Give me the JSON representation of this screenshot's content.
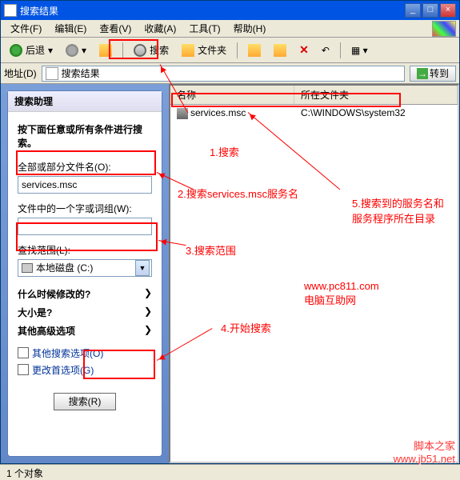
{
  "title": "搜索结果",
  "menu": {
    "file": "文件(F)",
    "edit": "编辑(E)",
    "view": "查看(V)",
    "favorites": "收藏(A)",
    "tools": "工具(T)",
    "help": "帮助(H)"
  },
  "toolbar": {
    "back": "后退",
    "search": "搜索",
    "folders": "文件夹"
  },
  "addressbar": {
    "label": "地址(D)",
    "value": "搜索结果",
    "go": "转到"
  },
  "sidebar": {
    "title": "搜索助理",
    "instruction": "按下面任意或所有条件进行搜索。",
    "filename_label": "全部或部分文件名(O):",
    "filename_value": "services.msc",
    "content_label": "文件中的一个字或词组(W):",
    "content_value": "",
    "scope_label": "查找范围(L):",
    "scope_value": "本地磁盘 (C:)",
    "modified": "什么时候修改的?",
    "size": "大小是?",
    "advanced": "其他高级选项",
    "other_options": "其他搜索选项(O)",
    "change_prefs": "更改首选项(G)",
    "search_btn": "搜索(R)"
  },
  "results": {
    "col_name": "名称",
    "col_folder": "所在文件夹",
    "rows": [
      {
        "name": "services.msc",
        "folder": "C:\\WINDOWS\\system32"
      }
    ]
  },
  "status": "1 个对象",
  "annotations": {
    "a1": "1.搜索",
    "a2": "2.搜索services.msc服务名",
    "a3": "3.搜索范围",
    "a4": "4.开始搜索",
    "a5": "5.搜索到的服务名和服务程序所在目录",
    "site1": "www.pc811.com",
    "site2": "电脑互助网"
  },
  "watermark": "脚本之家\nwww.jb51.net"
}
